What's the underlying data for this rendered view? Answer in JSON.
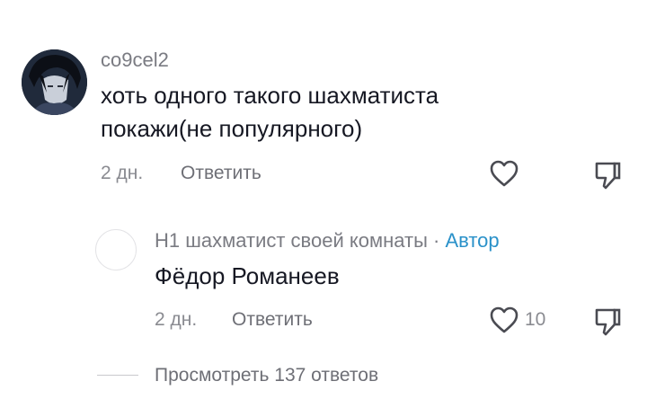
{
  "comment": {
    "username": "co9cel2",
    "text_line1": "хоть одного такого шахматиста",
    "text_line2": "покажи(не популярного)",
    "time": "2 дн.",
    "reply_label": "Ответить",
    "like_count": ""
  },
  "reply": {
    "username": "H1 шахматист своей комнаты",
    "separator": "·",
    "author_badge": "Автор",
    "text": "Фёдор Романеев",
    "time": "2 дн.",
    "reply_label": "Ответить",
    "like_count": "10"
  },
  "view_replies_label": "Просмотреть 137 ответов",
  "colors": {
    "author_badge": "#2a91c9",
    "muted_text": "#8a8b91",
    "main_text": "#161823"
  },
  "icons": {
    "like": "heart-icon",
    "dislike": "thumbs-down-icon"
  }
}
